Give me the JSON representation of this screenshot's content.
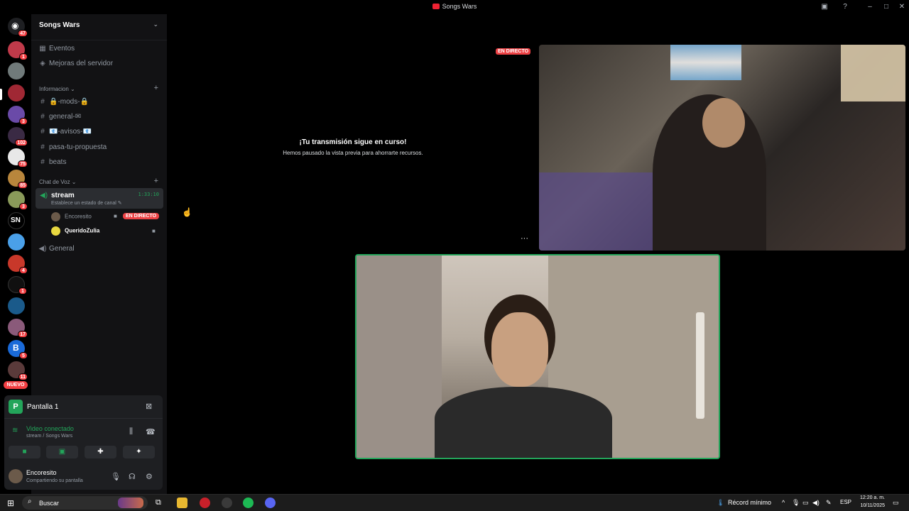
{
  "app": {
    "title": "Songs Wars"
  },
  "rail": {
    "servers": [
      {
        "badge": "47"
      },
      {
        "badge": "1"
      },
      {
        "badge": ""
      },
      {
        "badge": ""
      },
      {
        "badge": "3"
      },
      {
        "badge": "102"
      },
      {
        "badge": "75"
      },
      {
        "badge": "85"
      },
      {
        "badge": "3"
      },
      {
        "badge": ""
      },
      {
        "badge": ""
      },
      {
        "badge": "4"
      },
      {
        "badge": "1"
      },
      {
        "badge": ""
      },
      {
        "badge": "17"
      },
      {
        "badge": "5"
      },
      {
        "badge": "11"
      }
    ],
    "nuevo_label": "NUEVO"
  },
  "sidebar": {
    "server_name": "Songs Wars",
    "events": "Eventos",
    "boosts": "Mejoras del servidor",
    "category_info": "Informacion ⌄",
    "text_channels": [
      "🔒-mods-🔒",
      "general-✉",
      "📧-avisos-📧",
      "pasa-tu-propuesta",
      "beats"
    ],
    "category_voice": "Chat de Voz ⌄",
    "voice_channel": {
      "name": "stream",
      "status": "Establece un estado de canal ✎",
      "time": "1:33:10",
      "users": [
        {
          "name": "Encoresito",
          "live": "EN DIRECTO"
        },
        {
          "name": "QueridoZulia"
        }
      ]
    },
    "voice_channel_2": "General"
  },
  "panel": {
    "screen_label": "Pantalla 1",
    "video_connected": "Video conectado",
    "video_sub": "stream / Songs Wars",
    "user_name": "Encoresito",
    "user_status": "Compartiendo su pantalla"
  },
  "main": {
    "live_label": "EN DIRECTO",
    "paused_title": "¡Tu transmisión sigue en curso!",
    "paused_sub": "Hemos pausado la vista previa para ahorrarte recursos."
  },
  "taskbar": {
    "search": "Buscar",
    "weather": "Récord mínimo",
    "lang": "ESP",
    "time": "12:20 a. m.",
    "date": "10/11/2025"
  },
  "colors": {
    "accent_green": "#23a55a",
    "live_red": "#ed4245",
    "badge_red": "#f23f43"
  }
}
